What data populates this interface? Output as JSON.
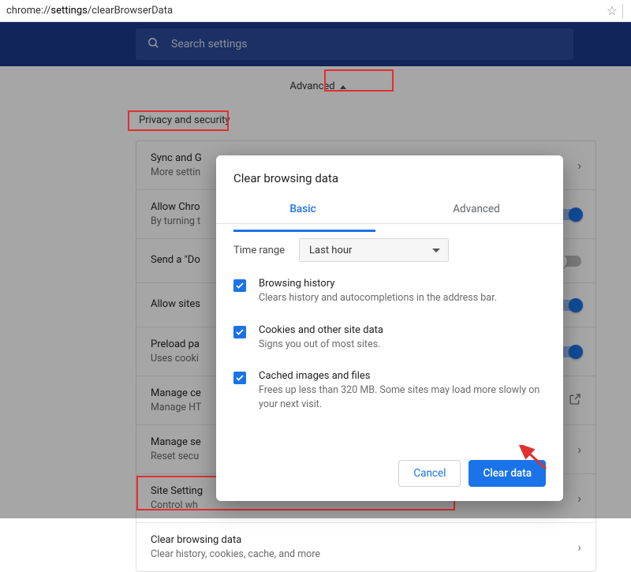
{
  "url": {
    "prefix": "chrome://",
    "bold": "settings",
    "suffix": "/clearBrowserData"
  },
  "search": {
    "placeholder": "Search settings"
  },
  "advanced": {
    "label": "Advanced"
  },
  "section": {
    "title": "Privacy and security"
  },
  "rows": [
    {
      "title": "Sync and G",
      "sub": "More settin",
      "control": "chevron"
    },
    {
      "title": "Allow Chro",
      "sub": "By turning t",
      "control": "toggle-on"
    },
    {
      "title": "Send a \"Do",
      "sub": "",
      "control": "toggle-off"
    },
    {
      "title": "Allow sites",
      "sub": "",
      "control": "toggle-on"
    },
    {
      "title": "Preload pa",
      "sub": "Uses cooki",
      "control": "toggle-on"
    },
    {
      "title": "Manage ce",
      "sub": "Manage HT",
      "control": "ext"
    },
    {
      "title": "Manage se",
      "sub": "Reset secu",
      "control": "chevron"
    },
    {
      "title": "Site Setting",
      "sub": "Control wh",
      "control": "chevron"
    },
    {
      "title": "Clear browsing data",
      "sub": "Clear history, cookies, cache, and more",
      "control": "chevron"
    }
  ],
  "dialog": {
    "title": "Clear browsing data",
    "tabs": {
      "basic": "Basic",
      "advanced": "Advanced"
    },
    "time_label": "Time range",
    "time_value": "Last hour",
    "options": [
      {
        "title": "Browsing history",
        "sub": "Clears history and autocompletions in the address bar."
      },
      {
        "title": "Cookies and other site data",
        "sub": "Signs you out of most sites."
      },
      {
        "title": "Cached images and files",
        "sub": "Frees up less than 320 MB. Some sites may load more slowly on your next visit."
      }
    ],
    "cancel": "Cancel",
    "confirm": "Clear data"
  }
}
